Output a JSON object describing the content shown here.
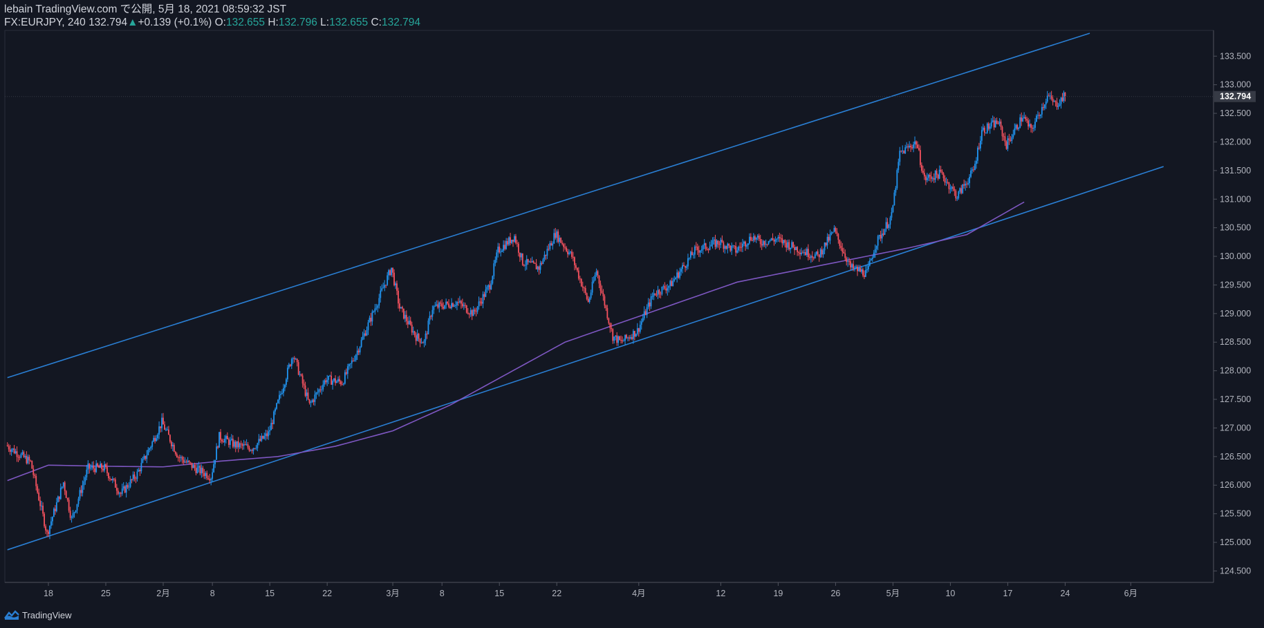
{
  "header": {
    "line1": "lebain TradingView.com で公開, 5月 18, 2021 08:59:32 JST",
    "symbol": "FX:EURJPY, 240",
    "last": "132.794",
    "change": "+0.139 (+0.1%)",
    "o_label": "O:",
    "o_value": "132.655",
    "h_label": "H:",
    "h_value": "132.796",
    "l_label": "L:",
    "l_value": "132.655",
    "c_label": "C:",
    "c_value": "132.794"
  },
  "footer": {
    "brand": "TradingView",
    "icon": "tradingview-logo-icon"
  },
  "colors": {
    "background": "#131722",
    "up": "#2196f3",
    "down": "#f7525f",
    "ma": "#7e57c2",
    "channel": "#2a7fd4",
    "axis_text": "#b2b5be",
    "last_label_bg": "#363a45"
  },
  "chart_data": {
    "type": "candlestick",
    "ylim": [
      124.3,
      133.95
    ],
    "y_ticks": [
      "124.500",
      "125.000",
      "125.500",
      "126.000",
      "126.500",
      "127.000",
      "127.500",
      "128.000",
      "128.500",
      "129.000",
      "129.500",
      "130.000",
      "130.500",
      "131.000",
      "131.500",
      "132.000",
      "132.500",
      "133.000",
      "133.500"
    ],
    "last_price": "132.794",
    "x_ticks": [
      {
        "label": "18",
        "day": 3
      },
      {
        "label": "25",
        "day": 10
      },
      {
        "label": "2月",
        "day": 17
      },
      {
        "label": "8",
        "day": 23
      },
      {
        "label": "15",
        "day": 30
      },
      {
        "label": "22",
        "day": 37
      },
      {
        "label": "3月",
        "day": 45
      },
      {
        "label": "8",
        "day": 51
      },
      {
        "label": "15",
        "day": 58
      },
      {
        "label": "22",
        "day": 65
      },
      {
        "label": "4月",
        "day": 75
      },
      {
        "label": "12",
        "day": 85
      },
      {
        "label": "19",
        "day": 92
      },
      {
        "label": "26",
        "day": 99
      },
      {
        "label": "5月",
        "day": 106
      },
      {
        "label": "10",
        "day": 113
      },
      {
        "label": "17",
        "day": 120
      },
      {
        "label": "24",
        "day": 127
      },
      {
        "label": "6月",
        "day": 135
      }
    ],
    "price_path": [
      [
        -2,
        126.7
      ],
      [
        1,
        126.4
      ],
      [
        3,
        125.15
      ],
      [
        5,
        126.05
      ],
      [
        6,
        125.4
      ],
      [
        8,
        126.3
      ],
      [
        10,
        126.3
      ],
      [
        12,
        125.85
      ],
      [
        14,
        126.2
      ],
      [
        17,
        127.1
      ],
      [
        19,
        126.5
      ],
      [
        21,
        126.3
      ],
      [
        23,
        126.15
      ],
      [
        24,
        126.85
      ],
      [
        26,
        126.7
      ],
      [
        28,
        126.65
      ],
      [
        30,
        126.9
      ],
      [
        33,
        128.3
      ],
      [
        35,
        127.4
      ],
      [
        37,
        127.85
      ],
      [
        39,
        127.8
      ],
      [
        41,
        128.4
      ],
      [
        43,
        129.1
      ],
      [
        45,
        129.8
      ],
      [
        46,
        129.1
      ],
      [
        48,
        128.6
      ],
      [
        49,
        128.5
      ],
      [
        50,
        129.1
      ],
      [
        53,
        129.2
      ],
      [
        55,
        129.0
      ],
      [
        57,
        129.5
      ],
      [
        58,
        130.1
      ],
      [
        60,
        130.35
      ],
      [
        61,
        129.9
      ],
      [
        63,
        129.8
      ],
      [
        65,
        130.4
      ],
      [
        67,
        130.0
      ],
      [
        69,
        129.2
      ],
      [
        70,
        129.75
      ],
      [
        72,
        128.6
      ],
      [
        73,
        128.5
      ],
      [
        75,
        128.7
      ],
      [
        77,
        129.35
      ],
      [
        79,
        129.5
      ],
      [
        82,
        130.1
      ],
      [
        85,
        130.25
      ],
      [
        87,
        130.1
      ],
      [
        89,
        130.35
      ],
      [
        90,
        130.25
      ],
      [
        92,
        130.3
      ],
      [
        95,
        130.1
      ],
      [
        97,
        130.0
      ],
      [
        99,
        130.45
      ],
      [
        101,
        129.8
      ],
      [
        103,
        129.7
      ],
      [
        104,
        130.2
      ],
      [
        106,
        130.7
      ],
      [
        107,
        131.8
      ],
      [
        109,
        132.0
      ],
      [
        110,
        131.35
      ],
      [
        112,
        131.45
      ],
      [
        114,
        131.05
      ],
      [
        116,
        131.5
      ],
      [
        117,
        132.2
      ],
      [
        119,
        132.35
      ],
      [
        120,
        131.95
      ],
      [
        122,
        132.45
      ],
      [
        123,
        132.2
      ],
      [
        125,
        132.8
      ],
      [
        126,
        132.65
      ],
      [
        127,
        132.79
      ]
    ],
    "ma_points": [
      [
        -2,
        126.08
      ],
      [
        3,
        126.35
      ],
      [
        10,
        126.33
      ],
      [
        17,
        126.32
      ],
      [
        24,
        126.42
      ],
      [
        31,
        126.5
      ],
      [
        38,
        126.68
      ],
      [
        45,
        126.95
      ],
      [
        52,
        127.4
      ],
      [
        59,
        127.95
      ],
      [
        66,
        128.5
      ],
      [
        73,
        128.85
      ],
      [
        80,
        129.2
      ],
      [
        87,
        129.55
      ],
      [
        94,
        129.75
      ],
      [
        101,
        129.95
      ],
      [
        108,
        130.15
      ],
      [
        115,
        130.38
      ],
      [
        122,
        130.95
      ]
    ],
    "channel_lines": [
      {
        "name": "upper",
        "points": [
          [
            -2,
            127.88
          ],
          [
            130,
            133.9
          ]
        ]
      },
      {
        "name": "lower",
        "points": [
          [
            -2,
            124.87
          ],
          [
            139,
            131.57
          ]
        ]
      }
    ]
  }
}
